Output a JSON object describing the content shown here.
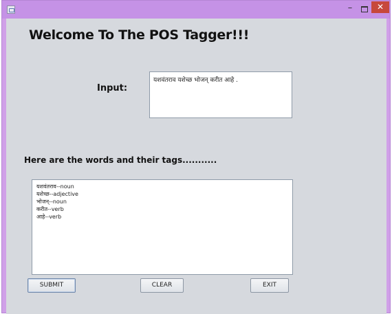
{
  "window": {
    "app_icon": "java-app-icon",
    "controls": {
      "minimize": "–",
      "close": "✕"
    }
  },
  "main": {
    "heading": "Welcome To The POS Tagger!!!",
    "input_label": "Input:",
    "input_value": "यशवंतराव यशेच्छ भोजन् करीत आहे .",
    "tags_heading": "Here are the words and their tags...........",
    "output_lines": [
      "यशवंतराव--noun",
      "यशेच्छ--adjective",
      "भोजन्--noun",
      "करीत--verb",
      "आहे--verb"
    ]
  },
  "buttons": {
    "submit": "SUBMIT",
    "clear": "CLEAR",
    "exit": "EXIT"
  },
  "colors": {
    "titlebar": "#c592e6",
    "content_bg": "#d6d9de",
    "close_button": "#c7483c"
  }
}
